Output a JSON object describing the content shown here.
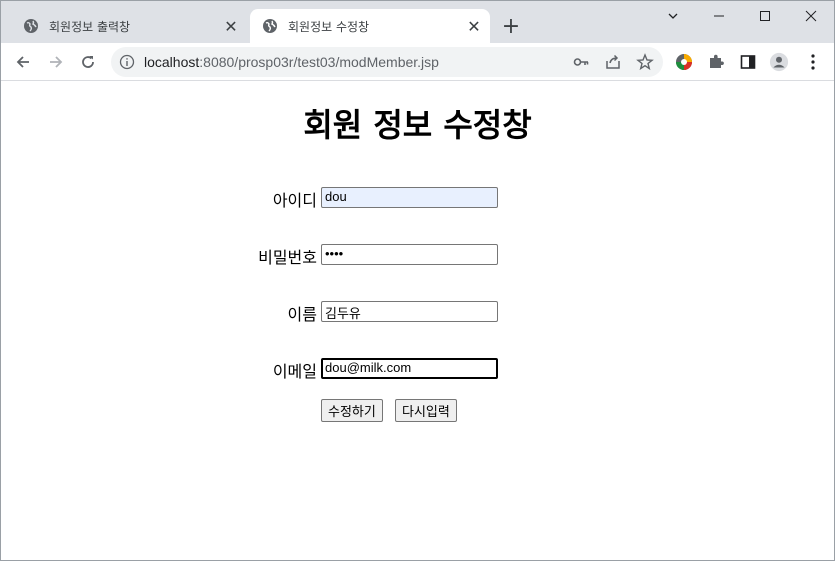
{
  "browser": {
    "tabs": [
      {
        "title": "회원정보 출력창",
        "active": false
      },
      {
        "title": "회원정보 수정창",
        "active": true
      }
    ],
    "new_tab": "+",
    "url_host": "localhost",
    "url_rest": ":8080/prosp03r/test03/modMember.jsp"
  },
  "page": {
    "title": "회원 정보 수정창",
    "fields": {
      "id_label": "아이디",
      "id_value": "dou",
      "password_label": "비밀번호",
      "password_value": "••••",
      "name_label": "이름",
      "name_value": "김두유",
      "email_label": "이메일",
      "email_value": "dou@milk.com"
    },
    "buttons": {
      "submit": "수정하기",
      "reset": "다시입력"
    }
  },
  "colors": {
    "tabstrip": "#dee1e6",
    "autofill": "#e8f0fe"
  }
}
